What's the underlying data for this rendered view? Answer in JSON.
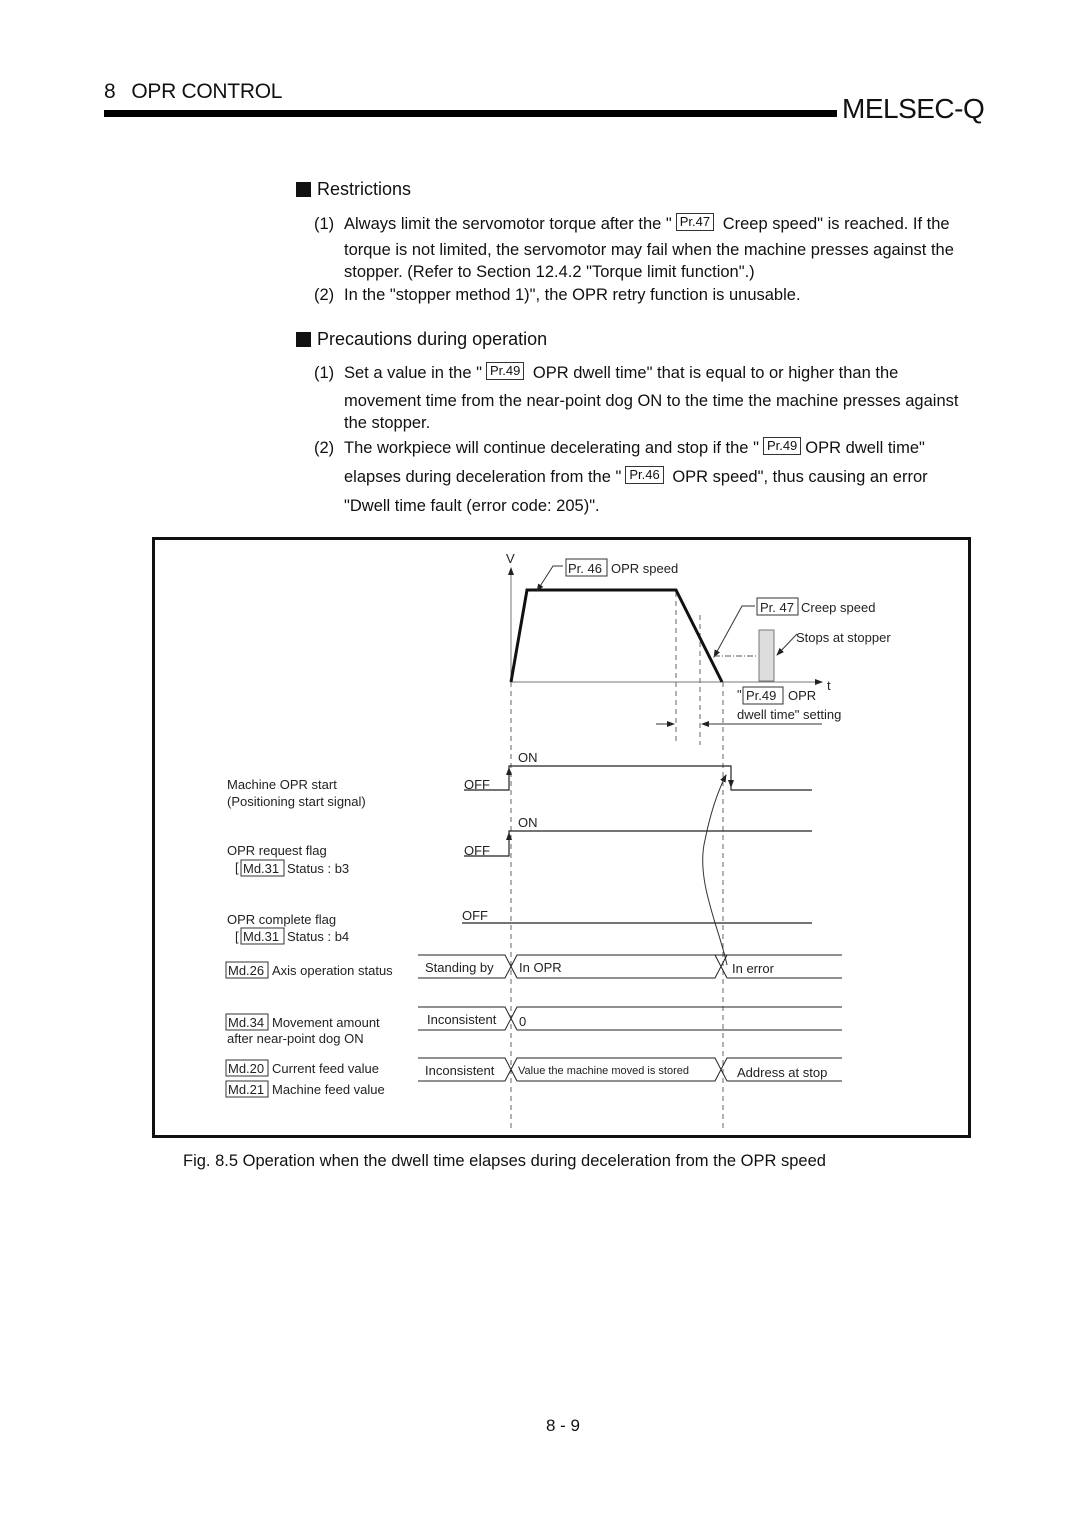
{
  "header": {
    "chapter_number": "8",
    "chapter_title": "OPR CONTROL",
    "brand": "MELSEC-Q"
  },
  "restrictions": {
    "title": "Restrictions",
    "items": [
      {
        "index": "(1)",
        "line1_pre": "Always limit the servomotor torque after the \"",
        "ref": "Pr.47",
        "line1_post": "Creep speed\" is reached. If the",
        "line2": "torque is not limited, the servomotor may fail when the machine presses against the",
        "line3": "stopper. (Refer to Section 12.4.2 \"Torque limit function\".)"
      },
      {
        "index": "(2)",
        "line1": "In the \"stopper method 1)\", the OPR retry function is unusable."
      }
    ]
  },
  "precautions": {
    "title": "Precautions during operation",
    "items": [
      {
        "index": "(1)",
        "line1_pre": "Set a value in the \"",
        "ref": "Pr.49",
        "line1_post": "OPR dwell time\" that is equal to or higher than the",
        "line2": "movement time from the near-point dog ON to the time the machine presses against",
        "line3": "the stopper."
      },
      {
        "index": "(2)",
        "line1_pre": "The workpiece will continue decelerating and stop if the \"",
        "ref1": "Pr.49",
        "line1_post": "OPR dwell time\"",
        "line2_pre": "elapses during deceleration from the \"",
        "ref2": "Pr.46",
        "line2_post": "OPR speed\", thus causing an error",
        "line3": "\"Dwell time fault (error code: 205)\"."
      }
    ]
  },
  "figure": {
    "speed_chart": {
      "v_axis_label": "V",
      "t_axis_label": "t",
      "opr_speed_ref": "Pr. 46",
      "opr_speed_label": "OPR speed",
      "creep_speed_ref": "Pr. 47",
      "creep_speed_label": "Creep speed",
      "stopper_label": "Stops at stopper",
      "dwell_quote_open": "\"",
      "dwell_ref": "Pr.49",
      "dwell_label_1": "OPR",
      "dwell_label_2": "dwell time\" setting"
    },
    "signals": [
      {
        "label_1": "Machine OPR start",
        "label_2": "(Positioning start signal)",
        "off": "OFF",
        "on": "ON"
      },
      {
        "label_1": "OPR request flag",
        "ref": "Md.31",
        "label_2": "Status : b3",
        "off": "OFF",
        "on": "ON"
      },
      {
        "label_1": "OPR complete flag",
        "ref": "Md.31",
        "label_2": "Status : b4",
        "off": "OFF"
      }
    ],
    "monitors": [
      {
        "ref": "Md.26",
        "label": "Axis operation status",
        "states": [
          "Standing by",
          "In OPR",
          "In error"
        ]
      },
      {
        "ref": "Md.34",
        "label": "Movement amount",
        "label_2": "after near-point dog ON",
        "states": [
          "Inconsistent",
          "0"
        ]
      },
      {
        "ref": "Md.20",
        "label": "Current feed value",
        "ref_2": "Md.21",
        "label_2": "Machine feed value",
        "states": [
          "Inconsistent",
          "Value the machine moved is stored",
          "Address at stop"
        ]
      }
    ]
  },
  "caption": "Fig. 8.5 Operation when the dwell time elapses during deceleration from the OPR speed",
  "page_number": "8 - 9"
}
